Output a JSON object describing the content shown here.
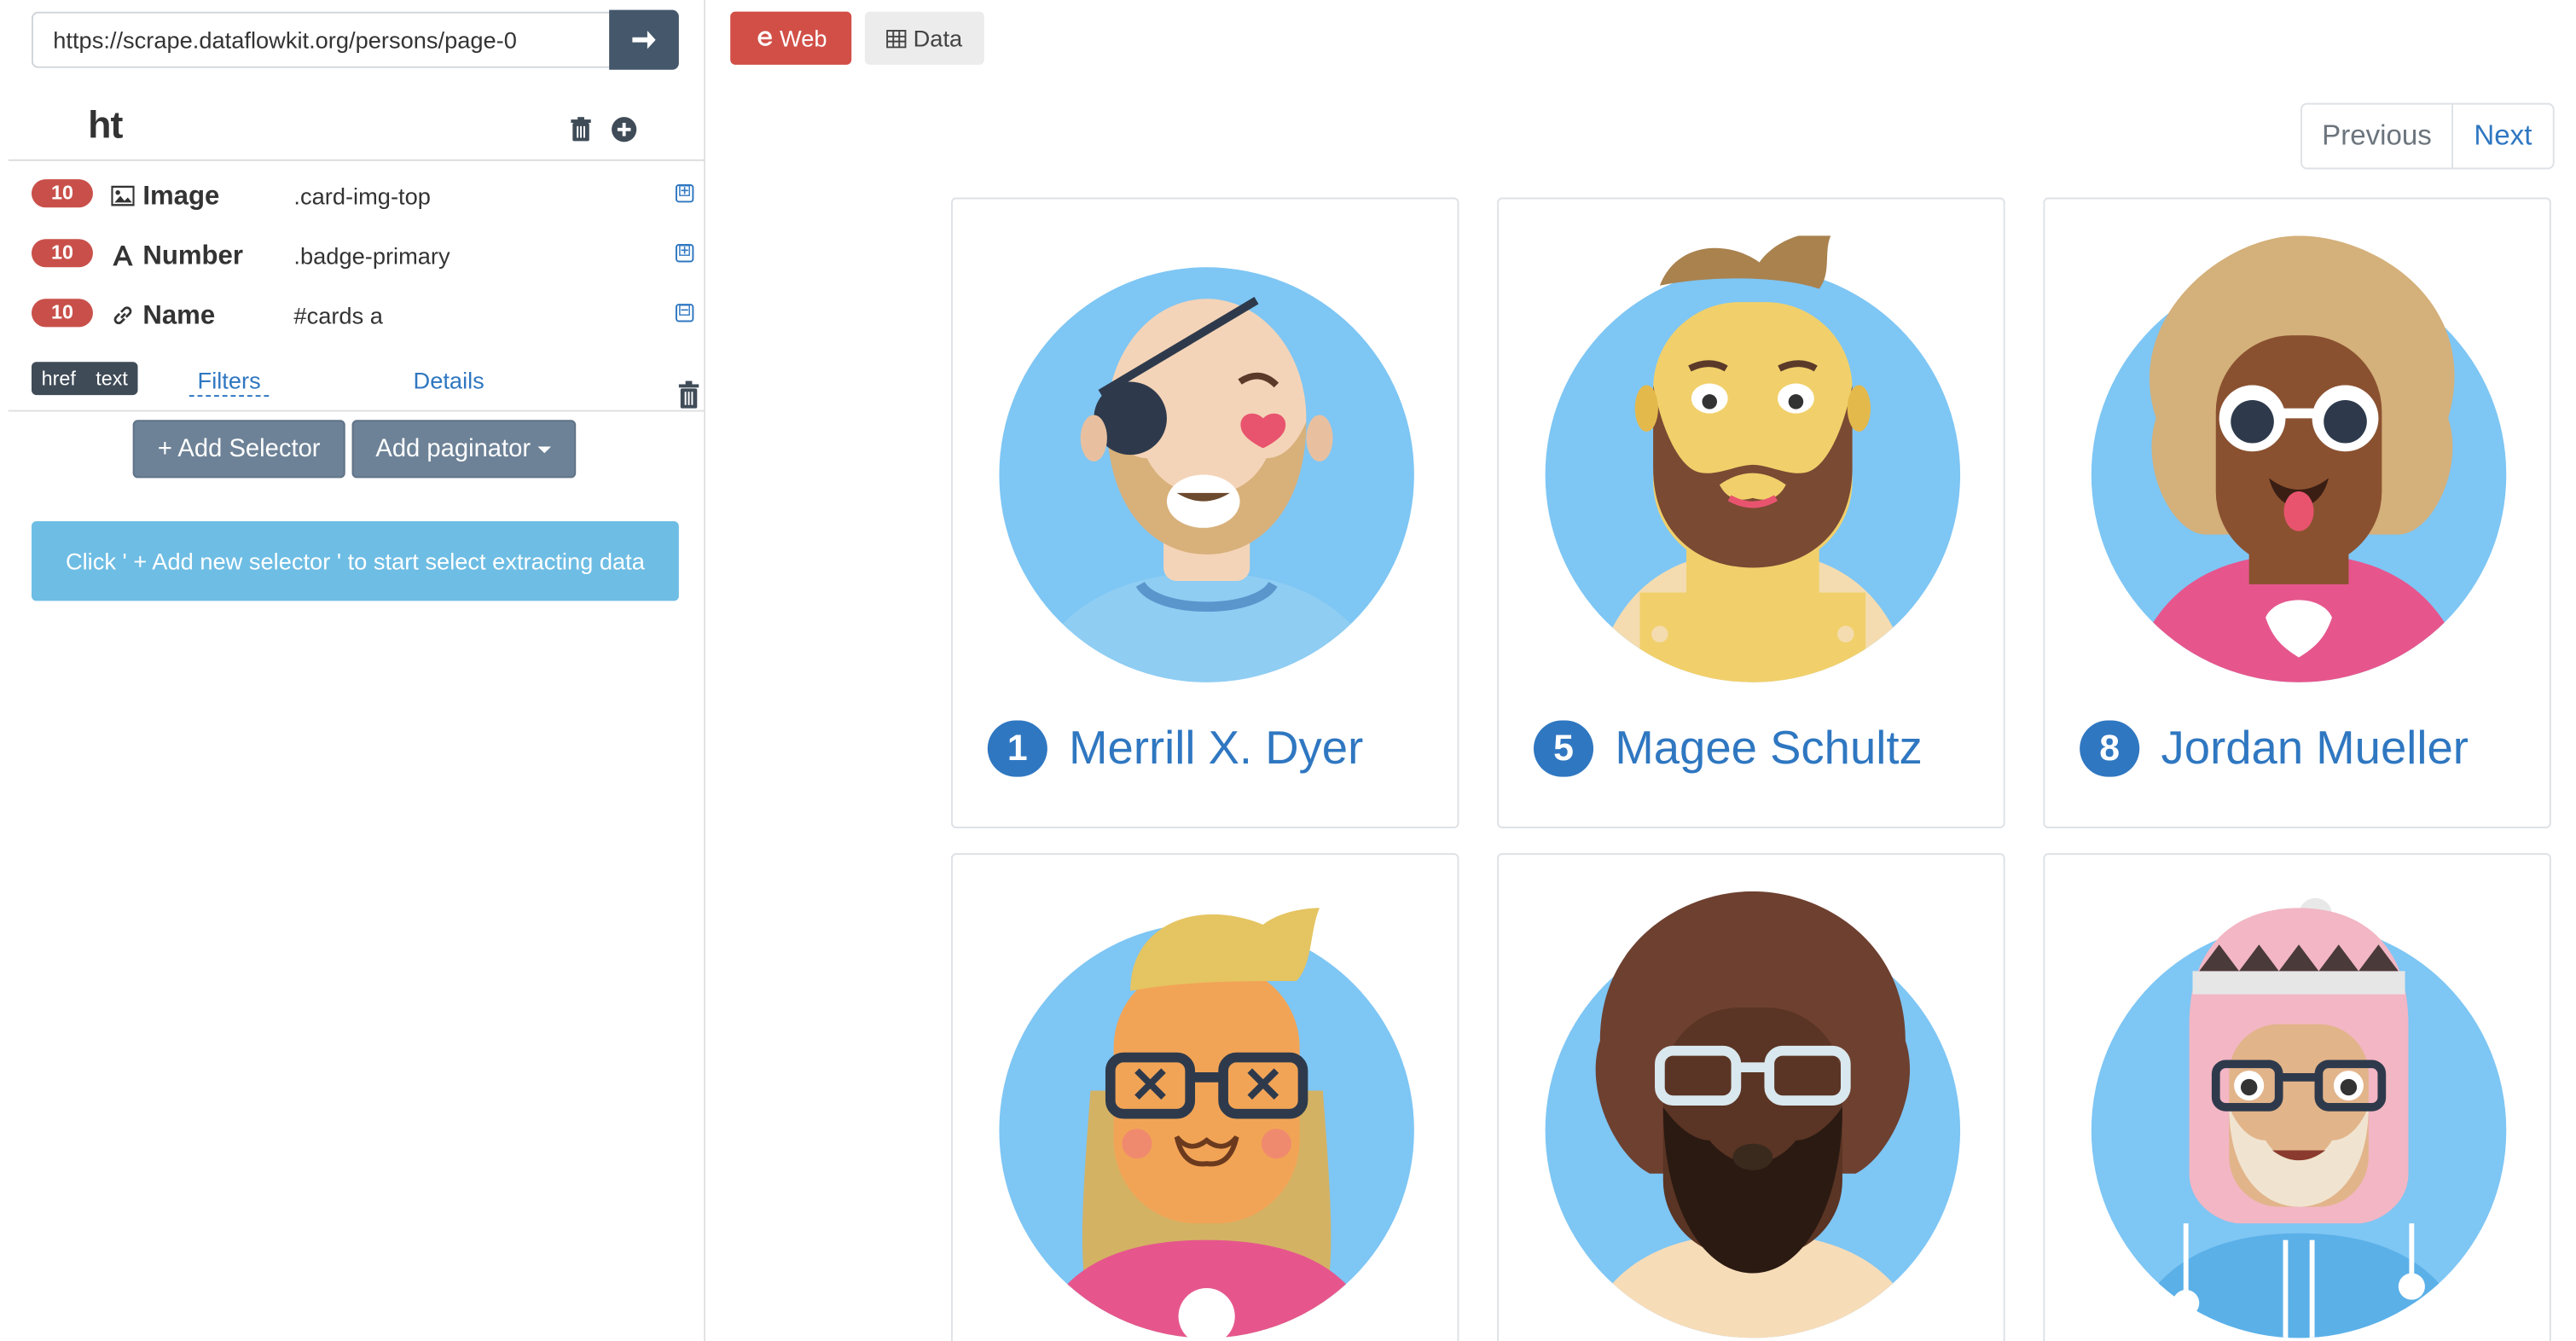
{
  "url_bar": {
    "value": "https://scrape.dataflowkit.org/persons/page-0"
  },
  "collection": {
    "title": "ht"
  },
  "selectors": [
    {
      "count": "10",
      "type": "Image",
      "css": ".card-img-top",
      "icon": "image-icon",
      "toggle": "⊞"
    },
    {
      "count": "10",
      "type": "Number",
      "css": ".badge-primary",
      "icon": "text-icon",
      "toggle": "⊞"
    },
    {
      "count": "10",
      "type": "Name",
      "css": "#cards a",
      "icon": "link-icon",
      "toggle": "⊟"
    }
  ],
  "attributes": {
    "items": [
      "href",
      "text"
    ],
    "filters_label": "Filters",
    "details_label": "Details"
  },
  "buttons": {
    "add_selector": "+ Add Selector",
    "add_paginator": "Add paginator"
  },
  "info": {
    "message": "Click ' + Add new selector ' to start select extracting data"
  },
  "tabs": {
    "web": "Web",
    "data": "Data"
  },
  "pager": {
    "previous": "Previous",
    "next": "Next"
  },
  "cards": [
    {
      "number": "1",
      "name": "Merrill X. Dyer"
    },
    {
      "number": "5",
      "name": "Magee Schultz"
    },
    {
      "number": "8",
      "name": "Jordan Mueller"
    },
    {
      "number": "",
      "name": ""
    },
    {
      "number": "",
      "name": ""
    },
    {
      "number": "",
      "name": ""
    }
  ],
  "colors": {
    "accent_blue": "#2f77c1",
    "badge_red": "#c9504a",
    "web_tab": "#d14f47",
    "info_blue": "#6ebde4",
    "avatar_bg": "#7ec6f4"
  }
}
